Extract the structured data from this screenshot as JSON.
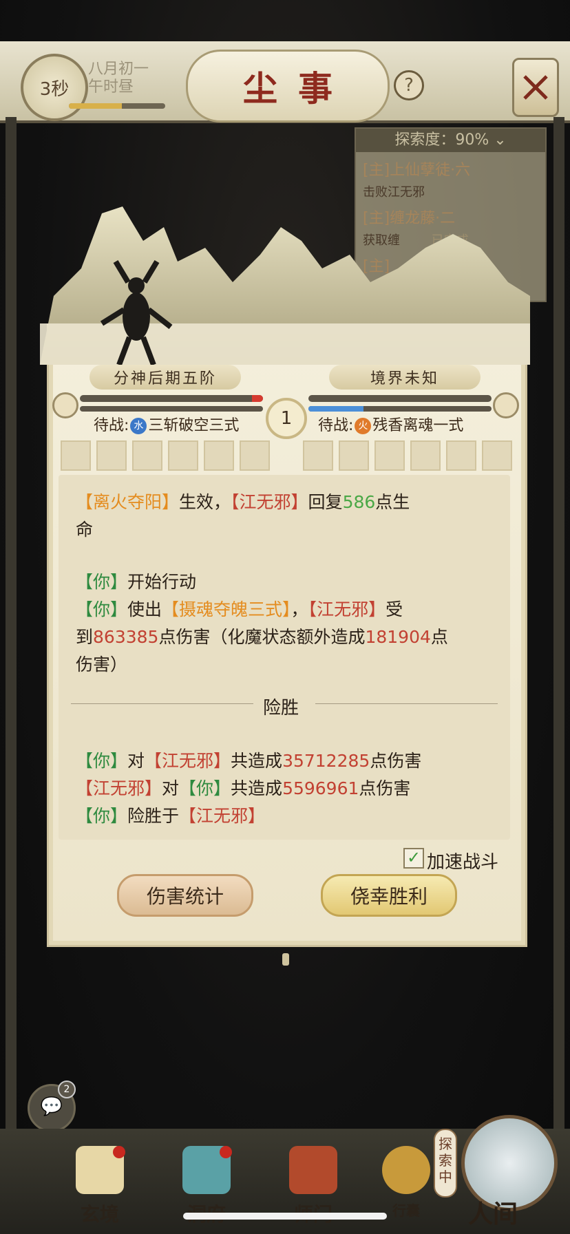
{
  "topbar": {
    "timer": "3秒",
    "date_line1": "八月初一",
    "date_line2": "午时昼",
    "time_progress": 0.55,
    "title": "尘事",
    "help_icon": "?",
    "close_icon": "crossed-swords-icon"
  },
  "quest_panel": {
    "header": "探索度：90%",
    "items": [
      {
        "title": "[主]上仙孽徒·六",
        "desc": "击败江无邪"
      },
      {
        "title": "[主]缠龙藤·二",
        "desc": "获取缠",
        "badge": "已完成"
      },
      {
        "title": "[主]",
        "desc": ""
      }
    ]
  },
  "battle": {
    "left": {
      "realm": "分神后期五阶",
      "hp_fraction": 0.06,
      "mp_fraction": 0.0,
      "status_prefix": "待战:",
      "element": "水",
      "element_color": "#3b78c8",
      "skill": "三斩破空三式"
    },
    "right": {
      "realm": "境界未知",
      "hp_fraction": 0.0,
      "mp_fraction": 0.3,
      "status_prefix": "待战:",
      "element": "火",
      "element_color": "#e07a2a",
      "skill": "残香离魂一式"
    },
    "round": "1"
  },
  "log": {
    "l1a": "【离火夺阳】",
    "l1b": "生效，",
    "l1c": "【江无邪】",
    "l1d": "回复",
    "l1e": "586",
    "l1f": "点生",
    "l2": "命",
    "l3a": "【你】",
    "l3b": "开始行动",
    "l4a": "【你】",
    "l4b": "使出",
    "l4c": "【摄魂夺魄三式】",
    "l4d": "，",
    "l4e": "【江无邪】",
    "l4f": "受",
    "l5a": "到",
    "l5b": "863385",
    "l5c": "点伤害（化魔状态额外造成",
    "l5d": "181904",
    "l5e": "点",
    "l6": "伤害）",
    "divider": "险胜",
    "l7a": "【你】",
    "l7b": "对",
    "l7c": "【江无邪】",
    "l7d": "共造成",
    "l7e": "35712285",
    "l7f": "点伤害",
    "l8a": "【江无邪】",
    "l8b": "对",
    "l8c": "【你】",
    "l8d": "共造成",
    "l8e": "5596961",
    "l8f": "点伤害",
    "l9a": "【你】",
    "l9b": "险胜于",
    "l9c": "【江无邪】"
  },
  "controls": {
    "speed_label": "加速战斗",
    "speed_checked": true,
    "damage_button": "伤害统计",
    "win_button": "侥幸胜利"
  },
  "chat": {
    "count": "2"
  },
  "bottom_nav": {
    "items": [
      {
        "label": "玄境",
        "color": "#e7d7a6"
      },
      {
        "label": "洞府",
        "color": "#5aa1a6"
      },
      {
        "label": "师门",
        "color": "#b24a2c"
      },
      {
        "label": "行囊",
        "color": "#c89a3b"
      }
    ],
    "explore_tag": "探索中",
    "world_label": "人间"
  }
}
